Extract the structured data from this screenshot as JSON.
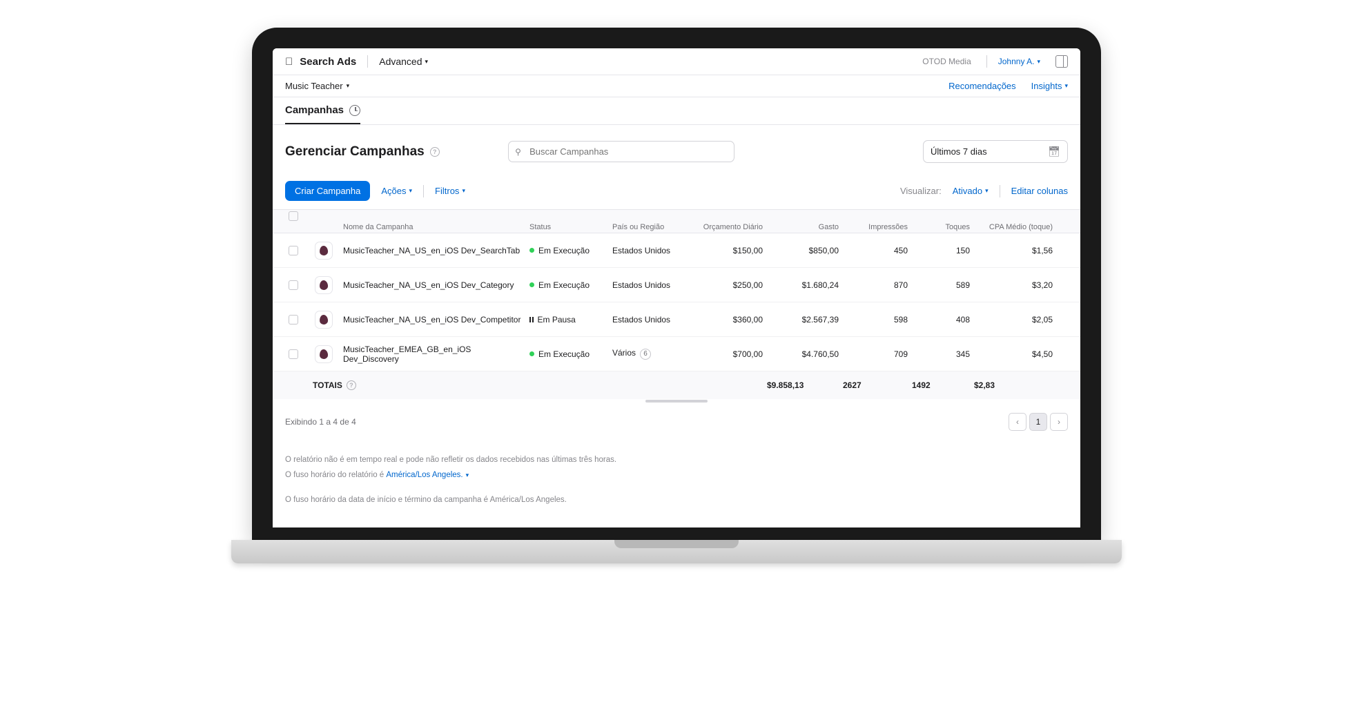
{
  "header": {
    "app_name": "Search Ads",
    "tier": "Advanced",
    "org": "OTOD Media",
    "user": "Johnny A."
  },
  "breadcrumb": {
    "app": "Music Teacher"
  },
  "nav": {
    "recommendations": "Recomendações",
    "insights": "Insights"
  },
  "tab": {
    "campaigns": "Campanhas"
  },
  "page": {
    "title": "Gerenciar Campanhas",
    "search_placeholder": "Buscar Campanhas",
    "date_range": "Últimos 7 dias"
  },
  "actions": {
    "create": "Criar Campanha",
    "actions": "Ações",
    "filters": "Filtros",
    "view_label": "Visualizar:",
    "view_value": "Ativado",
    "edit_columns": "Editar colunas"
  },
  "columns": {
    "name": "Nome da Campanha",
    "status": "Status",
    "region": "País ou Região",
    "budget": "Orçamento Diário",
    "spend": "Gasto",
    "impressions": "Impressões",
    "taps": "Toques",
    "cpa": "CPA Médio (toque)"
  },
  "status_labels": {
    "running": "Em Execução",
    "paused": "Em Pausa"
  },
  "rows": [
    {
      "name": "MusicTeacher_NA_US_en_iOS Dev_SearchTab",
      "status": "running",
      "region": "Estados Unidos",
      "region_count": null,
      "budget": "$150,00",
      "spend": "$850,00",
      "impressions": "450",
      "taps": "150",
      "cpa": "$1,56"
    },
    {
      "name": "MusicTeacher_NA_US_en_iOS Dev_Category",
      "status": "running",
      "region": "Estados Unidos",
      "region_count": null,
      "budget": "$250,00",
      "spend": "$1.680,24",
      "impressions": "870",
      "taps": "589",
      "cpa": "$3,20"
    },
    {
      "name": "MusicTeacher_NA_US_en_iOS Dev_Competitor",
      "status": "paused",
      "region": "Estados Unidos",
      "region_count": null,
      "budget": "$360,00",
      "spend": "$2.567,39",
      "impressions": "598",
      "taps": "408",
      "cpa": "$2,05"
    },
    {
      "name": "MusicTeacher_EMEA_GB_en_iOS Dev_Discovery",
      "status": "running",
      "region": "Vários",
      "region_count": "6",
      "budget": "$700,00",
      "spend": "$4.760,50",
      "impressions": "709",
      "taps": "345",
      "cpa": "$4,50"
    }
  ],
  "totals": {
    "label": "TOTAIS",
    "spend": "$9.858,13",
    "impressions": "2627",
    "taps": "1492",
    "cpa": "$2,83"
  },
  "pager": {
    "info": "Exibindo 1 a 4 de 4",
    "current": "1"
  },
  "footer": {
    "line1": "O relatório não é em tempo real e pode não refletir os dados recebidos nas últimas três horas.",
    "line2a": "O fuso horário do relatório é ",
    "tz": "América/Los Angeles.",
    "line3": "O fuso horário da data de início e término da campanha é América/Los Angeles."
  }
}
